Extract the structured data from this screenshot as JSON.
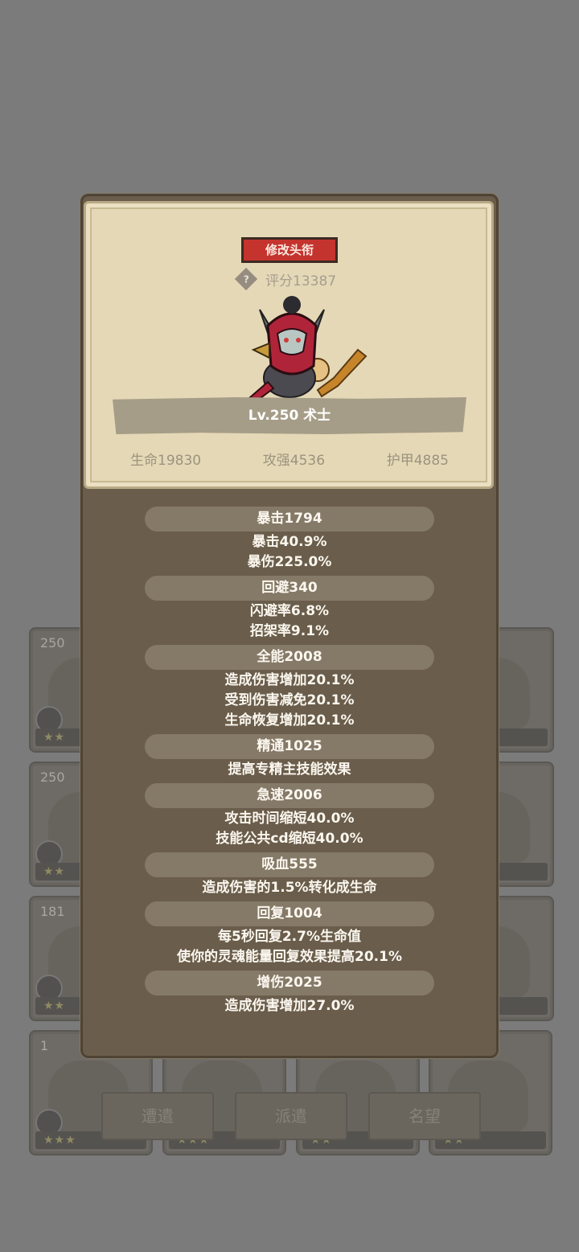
{
  "background": {
    "card_levels": [
      "250",
      "250",
      "181",
      "1"
    ],
    "tabs": [
      "遭遣",
      "派遣",
      "名望"
    ]
  },
  "header": {
    "rename_label": "修改头衔",
    "help_icon": "?",
    "score_text": "评分13387",
    "name_bar_text": "Lv.250 术士",
    "hp_text": "生命19830",
    "attack_text": "攻强4536",
    "armor_text": "护甲4885"
  },
  "stats": [
    {
      "title": "暴击1794",
      "details": [
        "暴击40.9%",
        "暴伤225.0%"
      ]
    },
    {
      "title": "回避340",
      "details": [
        "闪避率6.8%",
        "招架率9.1%"
      ]
    },
    {
      "title": "全能2008",
      "details": [
        "造成伤害增加20.1%",
        "受到伤害减免20.1%",
        "生命恢复增加20.1%"
      ]
    },
    {
      "title": "精通1025",
      "details": [
        "提高专精主技能效果"
      ]
    },
    {
      "title": "急速2006",
      "details": [
        "攻击时间缩短40.0%",
        "技能公共cd缩短40.0%"
      ]
    },
    {
      "title": "吸血555",
      "details": [
        "造成伤害的1.5%转化成生命"
      ]
    },
    {
      "title": "回复1004",
      "details": [
        "每5秒回复2.7%生命值",
        "使你的灵魂能量回复效果提高20.1%"
      ]
    },
    {
      "title": "增伤2025",
      "details": [
        "造成伤害增加27.0%"
      ]
    }
  ],
  "colors": {
    "rename_button": "#c4332e",
    "panel": "#6a5d4b",
    "parchment": "#e5d8b6"
  }
}
